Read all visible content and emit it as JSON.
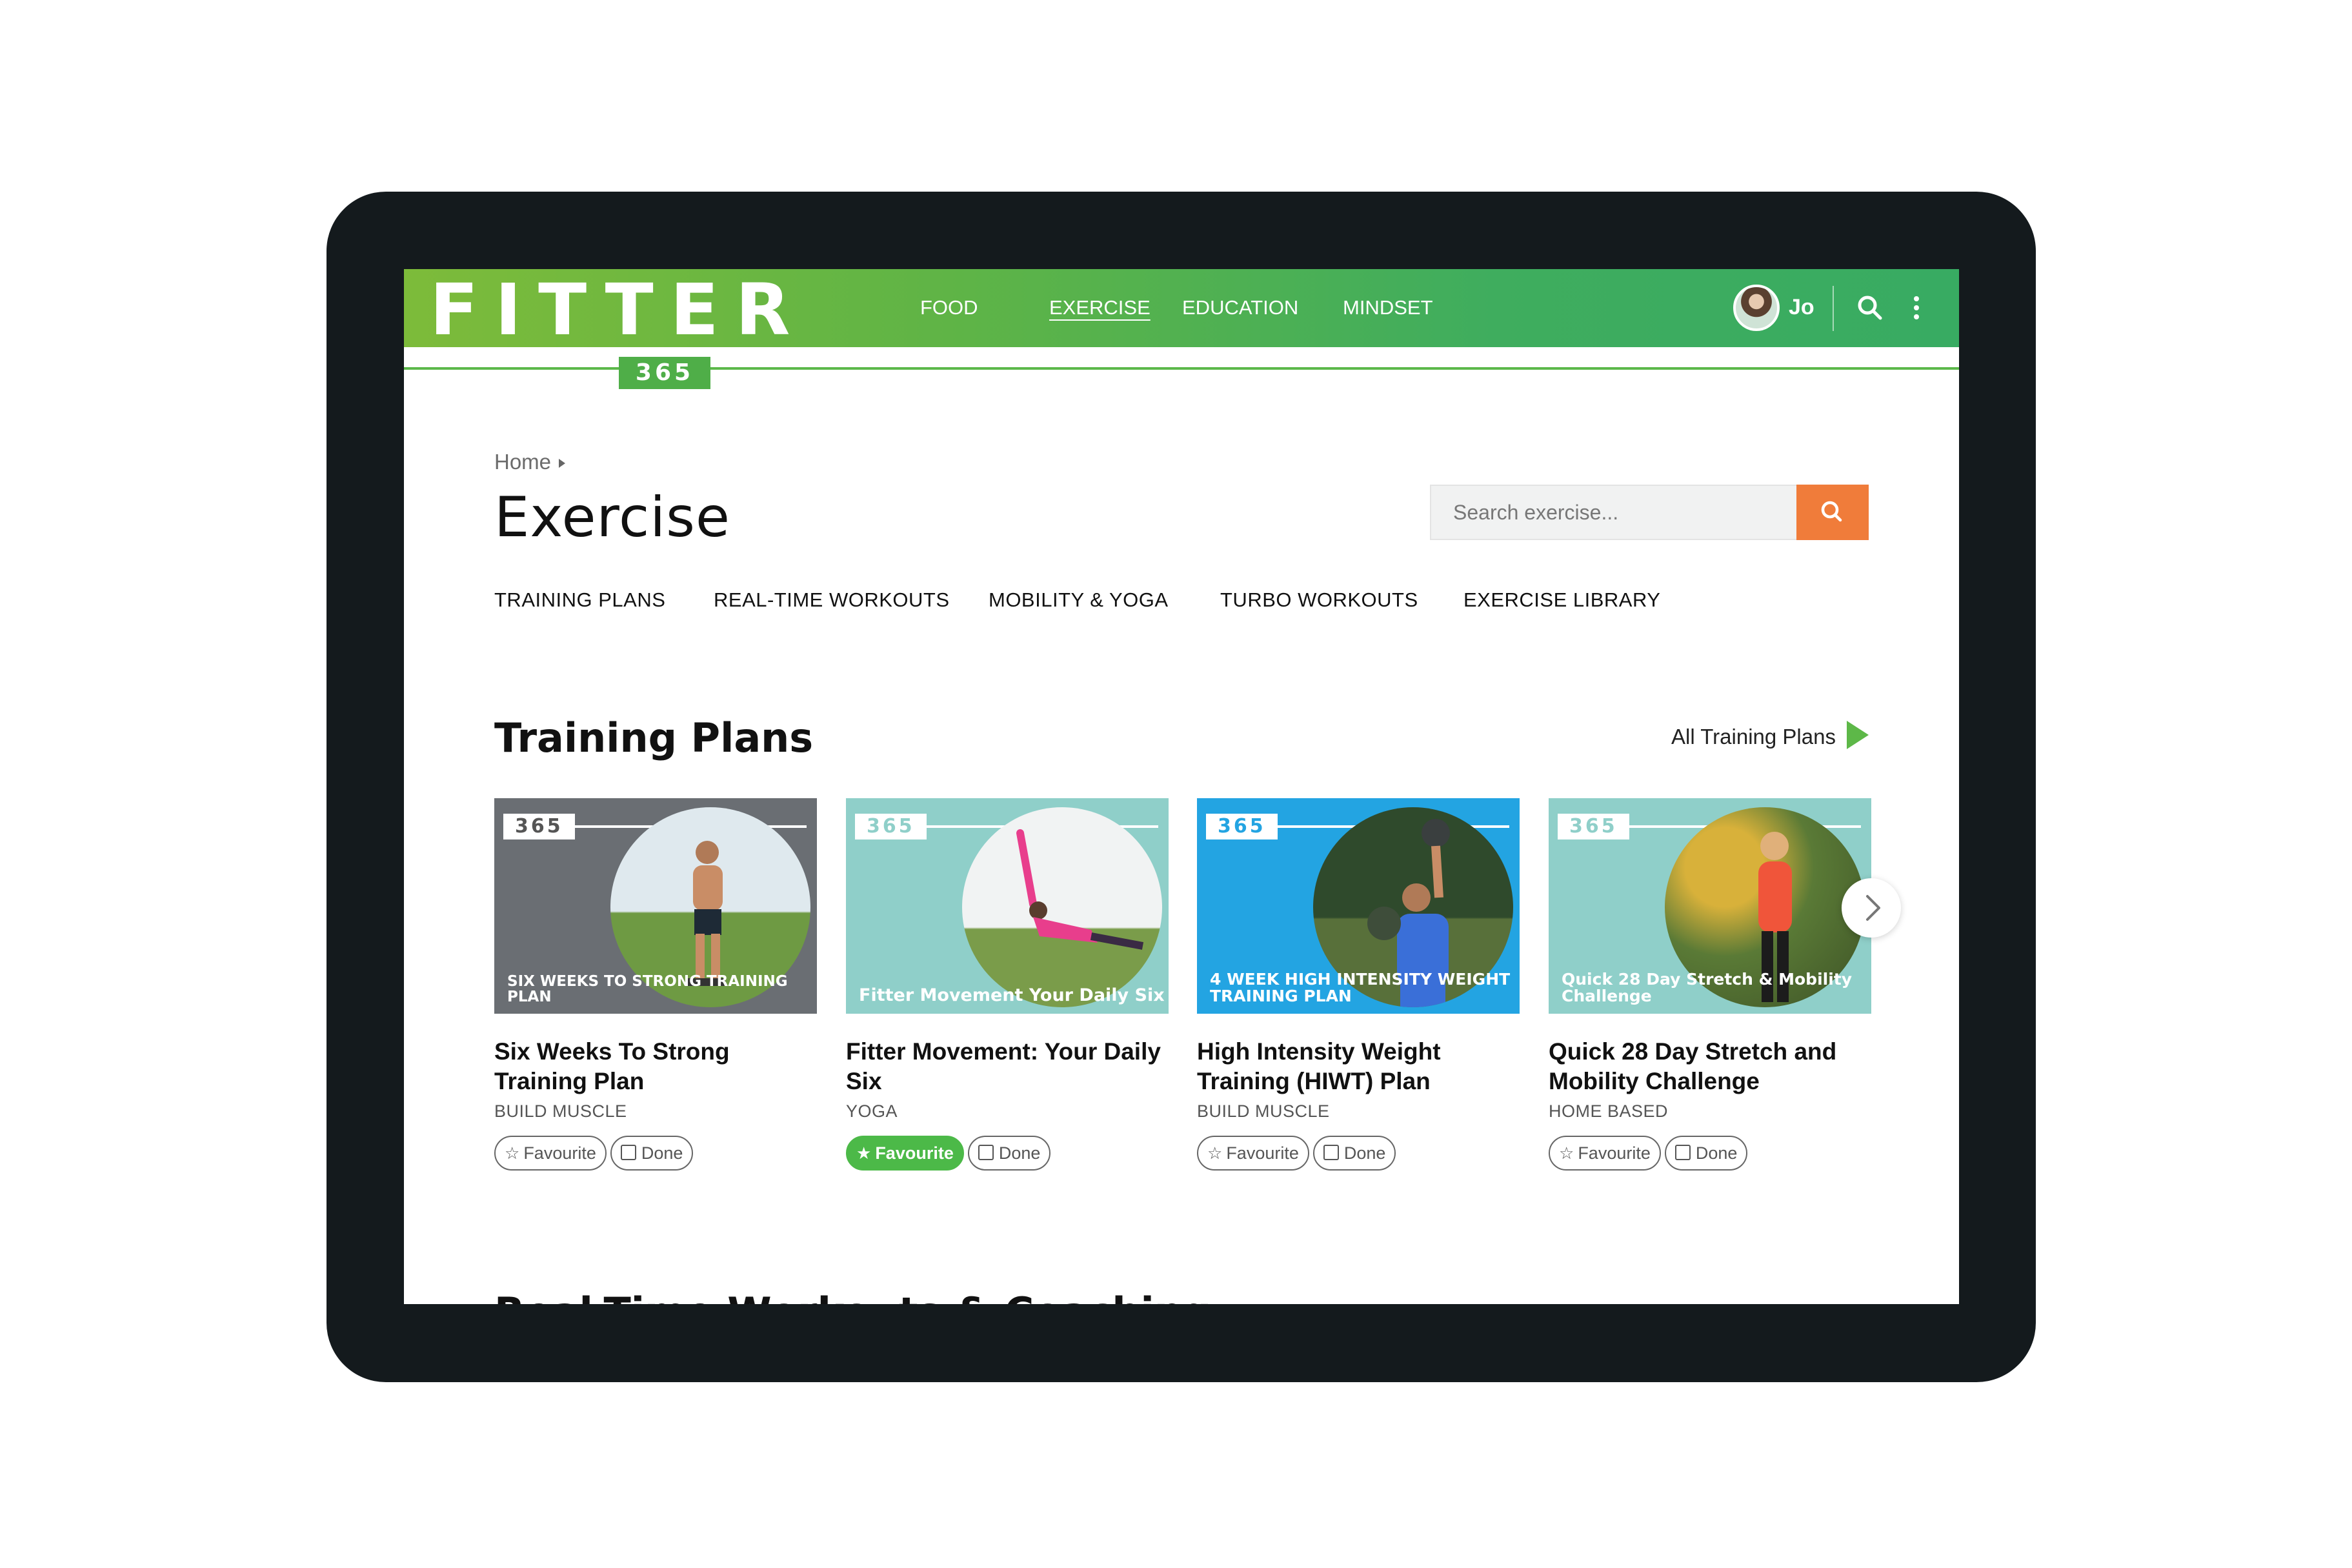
{
  "app": {
    "logo_text": "FITTER",
    "logo_badge": "365"
  },
  "header": {
    "nav": [
      "FOOD",
      "EXERCISE",
      "EDUCATION",
      "MINDSET"
    ],
    "active_nav": "EXERCISE",
    "user_name": "Jo",
    "icons": [
      "avatar",
      "search-icon",
      "more-vertical-icon"
    ]
  },
  "breadcrumb": {
    "home": "Home"
  },
  "page": {
    "title": "Exercise"
  },
  "search": {
    "placeholder": "Search exercise...",
    "value": ""
  },
  "subnav": [
    "TRAINING PLANS",
    "REAL-TIME WORKOUTS",
    "MOBILITY & YOGA",
    "TURBO WORKOUTS",
    "EXERCISE LIBRARY"
  ],
  "training_plans": {
    "heading": "Training Plans",
    "all_link": "All Training Plans",
    "cards": [
      {
        "badge": "365",
        "overlay": "SIX WEEKS TO STRONG TRAINING PLAN",
        "title": "Six Weeks To Strong Training Plan",
        "category": "BUILD MUSCLE",
        "favourite_label": "Favourite",
        "done_label": "Done",
        "favourited": false,
        "bg_color": "#6a6e73"
      },
      {
        "badge": "365",
        "overlay": "Fitter Movement Your Daily Six",
        "title": "Fitter Movement: Your Daily Six",
        "category": "YOGA",
        "favourite_label": "Favourite",
        "done_label": "Done",
        "favourited": true,
        "bg_color": "#8fcfc9"
      },
      {
        "badge": "365",
        "overlay": "4 WEEK HIGH INTENSITY WEIGHT TRAINING PLAN",
        "title": "High Intensity Weight Training (HIWT) Plan",
        "category": "BUILD MUSCLE",
        "favourite_label": "Favourite",
        "done_label": "Done",
        "favourited": false,
        "bg_color": "#23a4e2"
      },
      {
        "badge": "365",
        "overlay": "Quick 28 Day Stretch & Mobility Challenge",
        "title": "Quick 28 Day Stretch and Mobility Challenge",
        "category": "HOME BASED",
        "favourite_label": "Favourite",
        "done_label": "Done",
        "favourited": false,
        "bg_color": "#8fcfc9"
      }
    ]
  },
  "next_section_peek": "Real-Time Workouts & Coaching"
}
